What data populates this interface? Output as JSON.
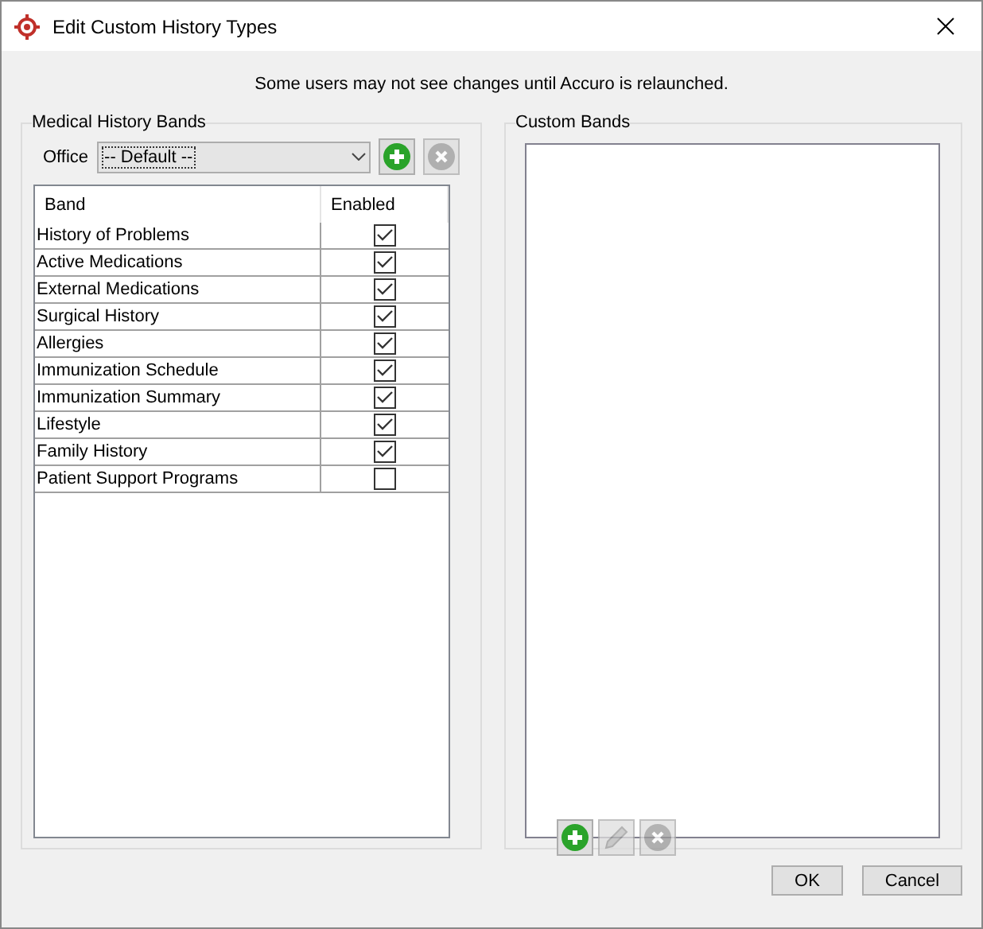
{
  "window": {
    "title": "Edit Custom History Types"
  },
  "notice": "Some users may not see changes until Accuro is relaunched.",
  "medical_history_bands": {
    "title": "Medical History Bands",
    "office_label": "Office",
    "office_value": "-- Default --",
    "buttons": [
      {
        "kind": "add",
        "disabled": false
      },
      {
        "kind": "remove",
        "disabled": true
      }
    ],
    "columns": [
      "Band",
      "Enabled"
    ],
    "rows": [
      {
        "band": "History of Problems",
        "checked": true
      },
      {
        "band": "Active Medications",
        "checked": true
      },
      {
        "band": "External Medications",
        "checked": true
      },
      {
        "band": "Surgical History",
        "checked": true
      },
      {
        "band": "Allergies",
        "checked": true
      },
      {
        "band": "Immunization Schedule",
        "checked": true
      },
      {
        "band": "Immunization Summary",
        "checked": true
      },
      {
        "band": "Lifestyle",
        "checked": true
      },
      {
        "band": "Family History",
        "checked": true
      },
      {
        "band": "Patient Support Programs",
        "checked": false
      }
    ]
  },
  "custom_bands": {
    "title": "Custom Bands",
    "buttons": [
      {
        "kind": "add",
        "disabled": false
      },
      {
        "kind": "edit",
        "disabled": true
      },
      {
        "kind": "remove",
        "disabled": true
      }
    ]
  },
  "buttons": [
    "OK",
    "Cancel"
  ]
}
